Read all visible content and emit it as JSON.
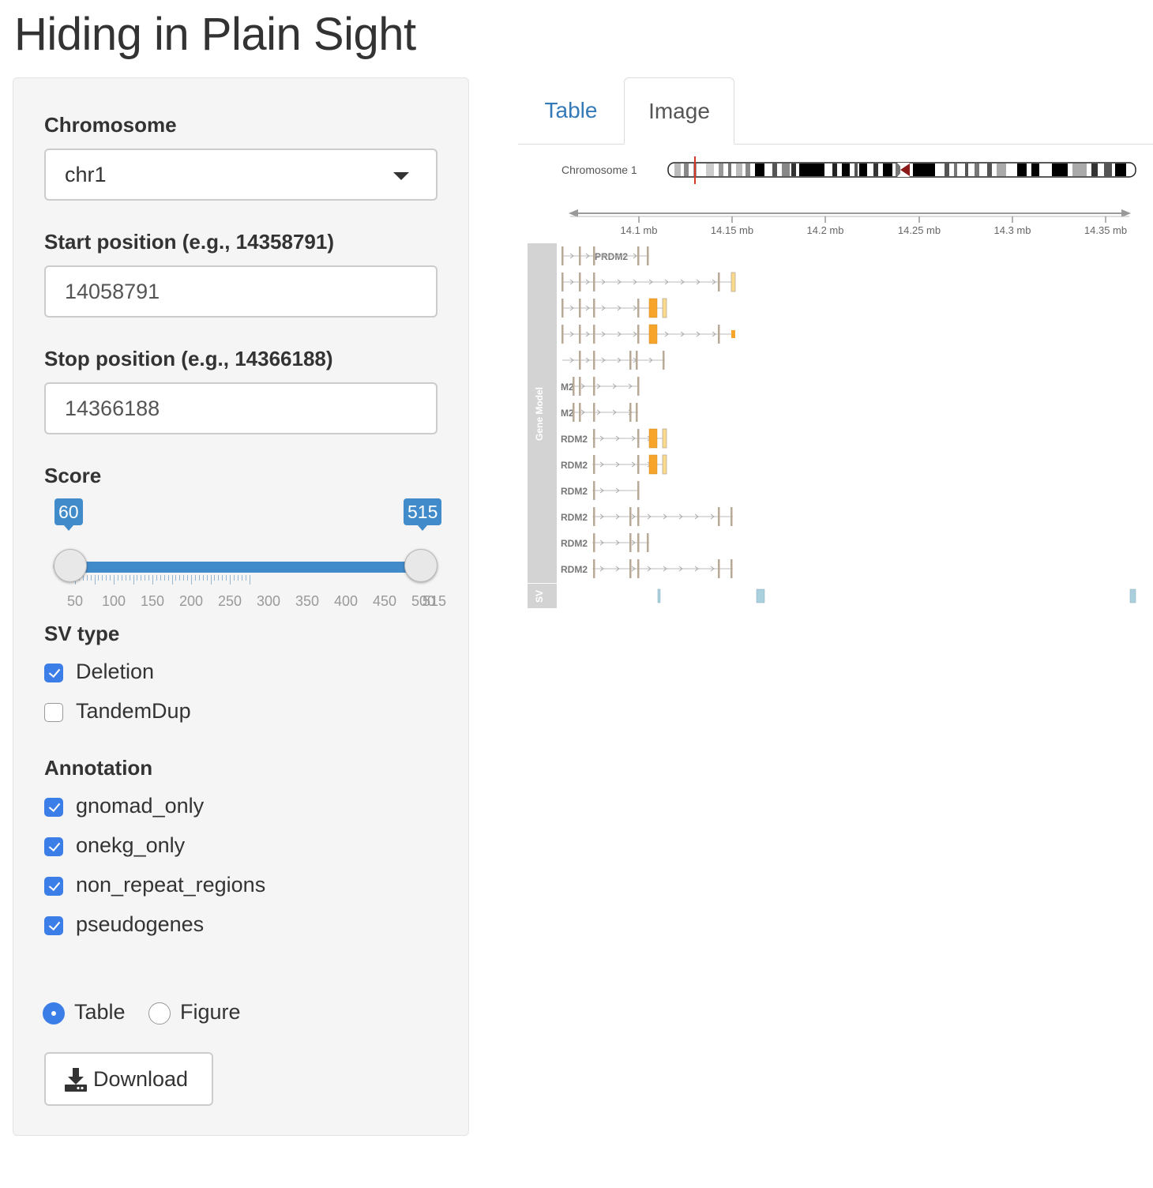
{
  "page": {
    "title": "Hiding in Plain Sight"
  },
  "sidebar": {
    "chromosome": {
      "label": "Chromosome",
      "value": "chr1"
    },
    "start": {
      "label": "Start position (e.g., 14358791)",
      "value": "14058791"
    },
    "stop": {
      "label": "Stop position (e.g., 14366188)",
      "value": "14366188"
    },
    "score": {
      "label": "Score",
      "min_value": "60",
      "max_value": "515",
      "ticks": [
        "50",
        "100",
        "150",
        "200",
        "250",
        "300",
        "350",
        "400",
        "450",
        "500",
        "515"
      ]
    },
    "sv_type": {
      "label": "SV type",
      "options": [
        {
          "label": "Deletion",
          "checked": true
        },
        {
          "label": "TandemDup",
          "checked": false
        }
      ]
    },
    "annotation": {
      "label": "Annotation",
      "options": [
        {
          "label": "gnomad_only",
          "checked": true
        },
        {
          "label": "onekg_only",
          "checked": true
        },
        {
          "label": "non_repeat_regions",
          "checked": true
        },
        {
          "label": "pseudogenes",
          "checked": true
        }
      ]
    },
    "output": {
      "options": [
        {
          "label": "Table",
          "selected": true
        },
        {
          "label": "Figure",
          "selected": false
        }
      ]
    },
    "download": {
      "label": "Download",
      "icon": "download-icon"
    }
  },
  "tabs": [
    {
      "label": "Table",
      "active": false
    },
    {
      "label": "Image",
      "active": true
    }
  ],
  "figure": {
    "ideogram_label": "Chromosome 1",
    "axis_ticks": [
      "14.1 mb",
      "14.15 mb",
      "14.2 mb",
      "14.25 mb",
      "14.3 mb",
      "14.35 mb"
    ],
    "track_labels": {
      "gene": "Gene Model",
      "sv": "SV"
    },
    "transcript_labels": [
      "PRDM2",
      "",
      "",
      "",
      "",
      "M2",
      "M2",
      "RDM2",
      "RDM2",
      "RDM2",
      "RDM2",
      "RDM2",
      "RDM2"
    ],
    "colors": {
      "accent": "#428bca",
      "exon": "#b9aa98",
      "utr": "#f6a42a",
      "sv": "#a9d0dc",
      "marker": "#d9362c"
    }
  }
}
